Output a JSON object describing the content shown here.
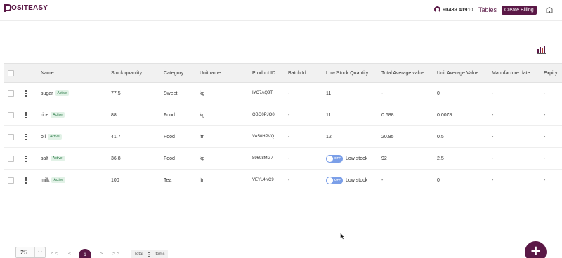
{
  "header": {
    "logo": "OSITEASY",
    "phone": "90439 41910",
    "tables_link": "Tables",
    "billing_button": "Create Billing"
  },
  "table": {
    "columns": [
      "Name",
      "Stock quantity",
      "Category",
      "Unitname",
      "Product ID",
      "Batch Id",
      "Low Stock Quantity",
      "Total Average value",
      "Unit Average Value",
      "Manufacture date",
      "Expiry"
    ],
    "rows": [
      {
        "name": "sugar",
        "status": "Active",
        "stock": "77.5",
        "category": "Sweet",
        "unit": "kg",
        "product_id": "IYC7AQ9T",
        "batch": "-",
        "low_stock": "11",
        "low_stock_toggle": false,
        "total_avg": "-",
        "unit_avg": "0",
        "mfg": "-",
        "expiry": "-"
      },
      {
        "name": "rice",
        "status": "Active",
        "stock": "88",
        "category": "Food",
        "unit": "kg",
        "product_id": "OBO0PJO0",
        "batch": "-",
        "low_stock": "11",
        "low_stock_toggle": false,
        "total_avg": "0.688",
        "unit_avg": "0.0078",
        "mfg": "-",
        "expiry": "-"
      },
      {
        "name": "oil",
        "status": "Active",
        "stock": "41.7",
        "category": "Food",
        "unit": "ltr",
        "product_id": "VA50HPVQ",
        "batch": "-",
        "low_stock": "12",
        "low_stock_toggle": false,
        "total_avg": "20.85",
        "unit_avg": "0.5",
        "mfg": "-",
        "expiry": "-"
      },
      {
        "name": "salt",
        "status": "Active",
        "stock": "36.8",
        "category": "Food",
        "unit": "kg",
        "product_id": "89698MG7",
        "batch": "-",
        "low_stock": "Low stock",
        "low_stock_toggle": true,
        "toggle_label": "OFF",
        "total_avg": "92",
        "unit_avg": "2.5",
        "mfg": "-",
        "expiry": "-"
      },
      {
        "name": "milk",
        "status": "Active",
        "stock": "100",
        "category": "Tea",
        "unit": "ltr",
        "product_id": "VEYL4NC9",
        "batch": "-",
        "low_stock": "Low stock",
        "low_stock_toggle": true,
        "toggle_label": "OFF",
        "total_avg": "-",
        "unit_avg": "0",
        "mfg": "-",
        "expiry": "-"
      }
    ]
  },
  "pagination": {
    "page_size": "25",
    "first": "< <",
    "prev": "<",
    "current_page": "1",
    "next": ">",
    "last": "> >",
    "total_label": "Total",
    "total_count": "5",
    "items_label": "items"
  },
  "fab_label": "+",
  "colors": {
    "brand": "#5a1846",
    "toggle": "#7b9fe8",
    "badge_bg": "#e2f2e7",
    "badge_text": "#2b7a47"
  }
}
